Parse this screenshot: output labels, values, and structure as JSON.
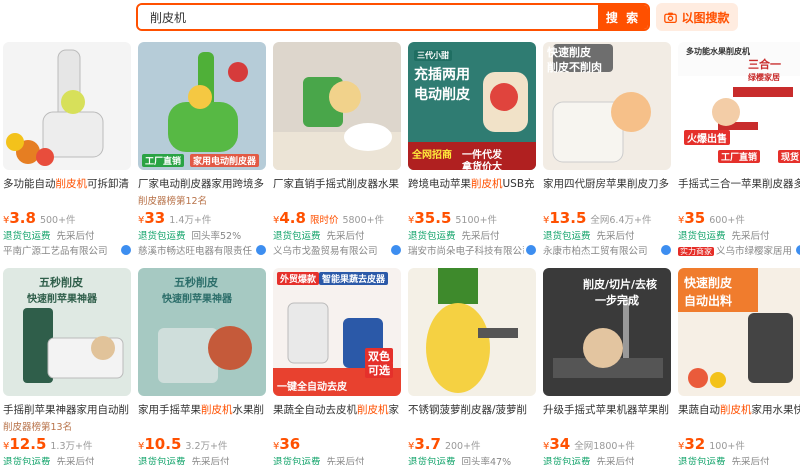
{
  "search": {
    "query": "削皮机",
    "button": "搜 索",
    "image_search": "以图搜款"
  },
  "colors": {
    "accent": "#ff5000",
    "free_shipping": "#11a36a"
  },
  "products": [
    {
      "title": "多功能自动削皮机可拆卸清",
      "title_hl": "削皮机",
      "price": "3.8",
      "price_tag": "",
      "sales": "500+件",
      "tags": [
        "退货包运费",
        "先采后付"
      ],
      "shop": "平南广源工艺品有限公司",
      "rank": "",
      "badge": "",
      "img_text": []
    },
    {
      "title": "厂家电动削皮器家用跨境多",
      "title_hl": "",
      "price": "33",
      "price_tag": "",
      "sales": "1.4万+件",
      "tags": [
        "退货包运费",
        "回头率52%"
      ],
      "shop": "慈溪市畅达旺电器有限责任",
      "rank": "削皮器榜第12名",
      "badge": "",
      "img_text": [
        "工厂直销",
        "家用电动削皮器"
      ]
    },
    {
      "title": "厂家直销手摇式削皮器水果",
      "title_hl": "",
      "price": "4.8",
      "price_tag": "限时价",
      "sales": "5800+件",
      "tags": [
        "退货包运费",
        "先采后付"
      ],
      "shop": "义乌市戈盈贸易有限公司",
      "rank": "",
      "badge": "",
      "img_text": []
    },
    {
      "title": "跨境电动苹果削皮机USB充",
      "title_hl": "削皮机",
      "price": "35.5",
      "price_tag": "",
      "sales": "5100+件",
      "tags": [
        "退货包运费",
        "先采后付"
      ],
      "shop": "瑞安市尚朵电子科技有限公司",
      "rank": "",
      "badge": "",
      "img_text": [
        "三代小甜",
        "充插两用",
        "电动削皮",
        "全网招商",
        "一件代发",
        "拿货价大"
      ]
    },
    {
      "title": "家用四代厨房苹果削皮刀多",
      "title_hl": "",
      "price": "13.5",
      "price_tag": "",
      "sales": "全网6.4万+件",
      "tags": [
        "退货包运费",
        "先采后付"
      ],
      "shop": "永康市柏杰工贸有限公司",
      "rank": "",
      "badge": "",
      "img_text": [
        "快速削皮",
        "削皮不削肉"
      ]
    },
    {
      "title": "手摇式三合一苹果削皮器多",
      "title_hl": "",
      "price": "35",
      "price_tag": "",
      "sales": "600+件",
      "tags": [
        "退货包运费",
        "先采后付"
      ],
      "shop": "义乌市绿樱家居用",
      "rank": "",
      "badge": "实力商家",
      "img_text": [
        "多功能水果削皮机",
        "三合一",
        "绿樱家居",
        "火爆出售",
        "工厂直销",
        "现货"
      ]
    },
    {
      "title": "手摇削苹果神器家用自动削",
      "title_hl": "",
      "price": "12.5",
      "price_tag": "",
      "sales": "1.3万+件",
      "tags": [
        "退货包运费",
        "先采后付"
      ],
      "shop": "",
      "rank": "削皮器榜第13名",
      "badge": "",
      "img_text": [
        "五秒削皮",
        "快速削苹果神器"
      ]
    },
    {
      "title": "家用手摇苹果削皮机水果削",
      "title_hl": "削皮机",
      "price": "10.5",
      "price_tag": "",
      "sales": "3.2万+件",
      "tags": [
        "退货包运费",
        "先采后付"
      ],
      "shop": "",
      "rank": "",
      "badge": "",
      "img_text": [
        "五秒削皮",
        "快速削苹果神器"
      ]
    },
    {
      "title": "果蔬全自动去皮机削皮机家",
      "title_hl": "削皮机",
      "price": "36",
      "price_tag": "",
      "sales": "",
      "tags": [
        "退货包运费",
        "先采后付"
      ],
      "shop": "",
      "rank": "",
      "badge": "",
      "img_text": [
        "外贸爆款",
        "智能果蔬去皮器",
        "一键全自动去皮",
        "双色",
        "可选"
      ]
    },
    {
      "title": "不锈钢菠萝削皮器/菠萝削",
      "title_hl": "",
      "price": "3.7",
      "price_tag": "",
      "sales": "200+件",
      "tags": [
        "退货包运费",
        "回头率47%"
      ],
      "shop": "",
      "rank": "",
      "badge": "",
      "img_text": []
    },
    {
      "title": "升级手摇式苹果机器苹果削",
      "title_hl": "",
      "price": "34",
      "price_tag": "",
      "sales": "全网1800+件",
      "tags": [
        "退货包运费",
        "先采后付"
      ],
      "shop": "",
      "rank": "",
      "badge": "",
      "img_text": [
        "削皮/切片/去核",
        "一步完成"
      ]
    },
    {
      "title": "果蔬自动削皮机家用水果快",
      "title_hl": "削皮机",
      "price": "32",
      "price_tag": "",
      "sales": "100+件",
      "tags": [
        "退货包运费",
        "先采后付"
      ],
      "shop": "",
      "rank": "",
      "badge": "",
      "img_text": [
        "快速削皮",
        "自动出料"
      ]
    }
  ]
}
